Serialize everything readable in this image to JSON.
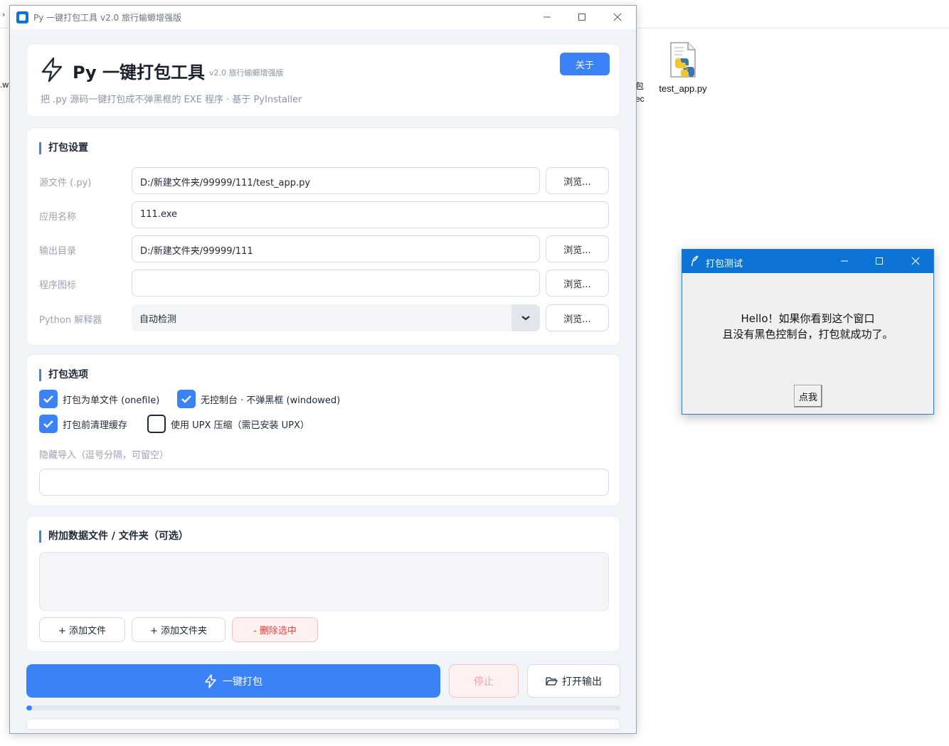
{
  "desktop": {
    "edge_left_text": ".w",
    "edge_right_line1": "包",
    "edge_right_line2": "ec",
    "file": {
      "name": "test_app.py",
      "icon": "python-file-icon"
    }
  },
  "main_window": {
    "title": "Py 一键打包工具  v2.0 旅行蝓螈增强版",
    "header": {
      "app_name": "Py 一键打包工具",
      "version": "v2.0 旅行蝓螈增强版",
      "subtitle": "把 .py 源码一键打包成不弹黑框的 EXE 程序 · 基于 PyInstaller",
      "about_label": "关于"
    },
    "settings": {
      "title": "打包设置",
      "source": {
        "label": "源文件 (.py)",
        "value": "D:/新建文件夹/99999/111/test_app.py",
        "browse": "浏览..."
      },
      "app_name": {
        "label": "应用名称",
        "value": "111.exe"
      },
      "output": {
        "label": "输出目录",
        "value": "D:/新建文件夹/99999/111",
        "browse": "浏览..."
      },
      "icon": {
        "label": "程序图标",
        "value": "",
        "browse": "浏览..."
      },
      "interpreter": {
        "label": "Python 解释器",
        "value": "自动检测",
        "browse": "浏览..."
      }
    },
    "options": {
      "title": "打包选项",
      "onefile": {
        "label": "打包为单文件 (onefile)",
        "checked": true
      },
      "windowed": {
        "label": "无控制台 · 不弹黑框 (windowed)",
        "checked": true
      },
      "clean": {
        "label": "打包前清理缓存",
        "checked": true
      },
      "upx": {
        "label": "使用 UPX 压缩（需已安装 UPX）",
        "checked": false
      },
      "hidden_imports_label": "隐藏导入（逗号分隔，可留空）",
      "hidden_imports_value": ""
    },
    "data_files": {
      "title": "附加数据文件 / 文件夹（可选）",
      "add_file": "+ 添加文件",
      "add_folder": "+ 添加文件夹",
      "remove": "- 删除选中"
    },
    "actions": {
      "build": "一键打包",
      "stop": "停止",
      "open_output": "打开输出"
    },
    "progress_fraction": 0.01,
    "colors": {
      "accent": "#3b82f6",
      "danger": "#ef4444",
      "titlebar_blue": "#0b74d4"
    }
  },
  "popup": {
    "title": "打包测试",
    "message_line1": "Hello！如果你看到这个窗口",
    "message_line2": "且没有黑色控制台，打包就成功了。",
    "button": "点我"
  }
}
